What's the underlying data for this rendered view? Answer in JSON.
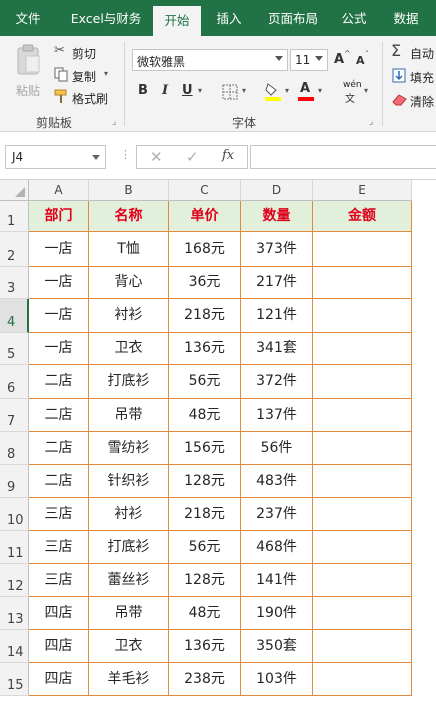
{
  "ribbon_tabs": [
    "文件",
    "Excel与财务",
    "开始",
    "插入",
    "页面布局",
    "公式",
    "数据"
  ],
  "active_tab": "开始",
  "clipboard": {
    "paste": "粘贴",
    "cut": "剪切",
    "copy": "复制",
    "format_painter": "格式刷",
    "group_label": "剪贴板"
  },
  "font": {
    "name": "微软雅黑",
    "size": "11",
    "grow": "A",
    "shrink": "A",
    "bold": "B",
    "italic": "I",
    "underline": "U",
    "phonetic": "wén",
    "font_color_glyph": "A",
    "group_label": "字体"
  },
  "editing": {
    "autosum": "自动",
    "fill": "填充",
    "clear": "清除"
  },
  "formula_bar": {
    "name_box": "J4",
    "fx": "fx",
    "formula": ""
  },
  "colors": {
    "accent": "#217346",
    "header_fill": "#e2efda",
    "header_text": "#e0001b",
    "border": "#e08a3c"
  },
  "sheet": {
    "columns": [
      "A",
      "B",
      "C",
      "D",
      "E"
    ],
    "header": [
      "部门",
      "名称",
      "单价",
      "数量",
      "金额"
    ],
    "row_numbers": [
      "1",
      "2",
      "3",
      "4",
      "5",
      "6",
      "7",
      "8",
      "9",
      "10",
      "11",
      "12",
      "13",
      "14",
      "15"
    ],
    "selected_row": "4",
    "rows": [
      [
        "一店",
        "T恤",
        "168元",
        "373件",
        ""
      ],
      [
        "一店",
        "背心",
        "36元",
        "217件",
        ""
      ],
      [
        "一店",
        "衬衫",
        "218元",
        "121件",
        ""
      ],
      [
        "一店",
        "卫衣",
        "136元",
        "341套",
        ""
      ],
      [
        "二店",
        "打底衫",
        "56元",
        "372件",
        ""
      ],
      [
        "二店",
        "吊带",
        "48元",
        "137件",
        ""
      ],
      [
        "二店",
        "雪纺衫",
        "156元",
        "56件",
        ""
      ],
      [
        "二店",
        "针织衫",
        "128元",
        "483件",
        ""
      ],
      [
        "三店",
        "衬衫",
        "218元",
        "237件",
        ""
      ],
      [
        "三店",
        "打底衫",
        "56元",
        "468件",
        ""
      ],
      [
        "三店",
        "蕾丝衫",
        "128元",
        "141件",
        ""
      ],
      [
        "四店",
        "吊带",
        "48元",
        "190件",
        ""
      ],
      [
        "四店",
        "卫衣",
        "136元",
        "350套",
        ""
      ],
      [
        "四店",
        "羊毛衫",
        "238元",
        "103件",
        ""
      ]
    ]
  }
}
